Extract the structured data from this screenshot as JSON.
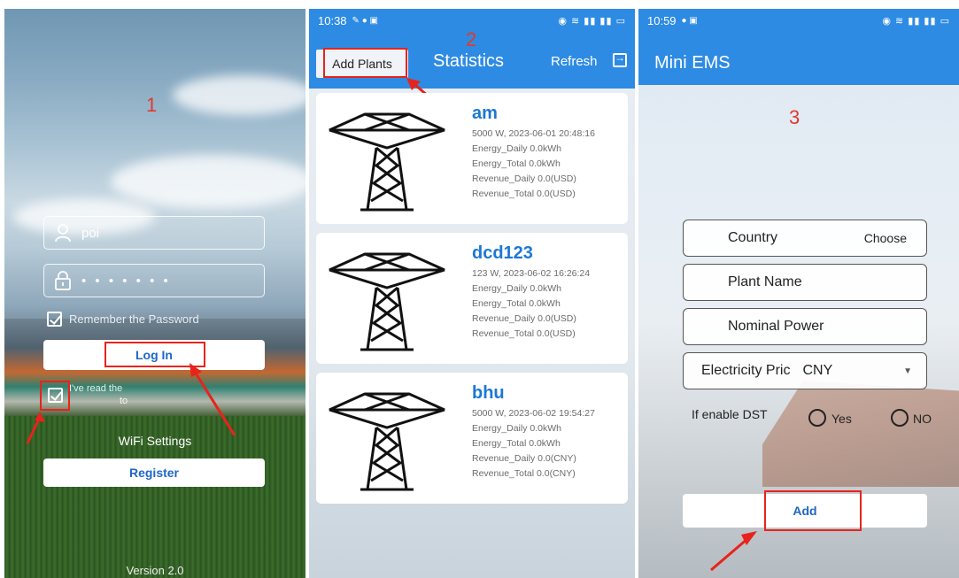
{
  "panel1": {
    "step": "1",
    "username_value": "poi",
    "password_mask": "• • • • • • •",
    "remember_label": "Remember the Password",
    "login_label": "Log In",
    "terms_prefix": "I've read the",
    "terms_to": "to",
    "wifi_label": "WiFi Settings",
    "register_label": "Register",
    "version": "Version 2.0",
    "icons": [
      "user-icon",
      "lock-icon",
      "checkbox-icon"
    ]
  },
  "panel2": {
    "step": "2",
    "status_time": "10:38",
    "add_plants_label": "Add Plants",
    "title": "Statistics",
    "refresh_label": "Refresh",
    "plants": [
      {
        "name": "am",
        "power_date": "5000 W, 2023-06-01 20:48:16",
        "energy_daily": "Energy_Daily    0.0kWh",
        "energy_total": "Energy_Total    0.0kWh",
        "revenue_daily": "Revenue_Daily 0.0(USD)",
        "revenue_total": "Revenue_Total 0.0(USD)"
      },
      {
        "name": "dcd123",
        "power_date": "123 W, 2023-06-02 16:26:24",
        "energy_daily": "Energy_Daily    0.0kWh",
        "energy_total": "Energy_Total    0.0kWh",
        "revenue_daily": "Revenue_Daily 0.0(USD)",
        "revenue_total": "Revenue_Total 0.0(USD)"
      },
      {
        "name": "bhu",
        "power_date": "5000 W, 2023-06-02 19:54:27",
        "energy_daily": "Energy_Daily    0.0kWh",
        "energy_total": "Energy_Total    0.0kWh",
        "revenue_daily": "Revenue_Daily 0.0(CNY)",
        "revenue_total": "Revenue_Total 0.0(CNY)"
      }
    ]
  },
  "panel3": {
    "step": "3",
    "status_time": "10:59",
    "title": "Mini EMS",
    "country_label": "Country",
    "country_value": "Choose",
    "plant_name_placeholder": "Plant Name",
    "nominal_power_placeholder": "Nominal Power",
    "electricity_price_label": "Electricity Pric",
    "currency_value": "CNY",
    "dst_label": "If enable DST",
    "dst_yes": "Yes",
    "dst_no": "NO",
    "add_label": "Add"
  },
  "colors": {
    "accent": "#2e8be3",
    "highlight": "#e8231b",
    "plant_name": "#1b78d4"
  }
}
